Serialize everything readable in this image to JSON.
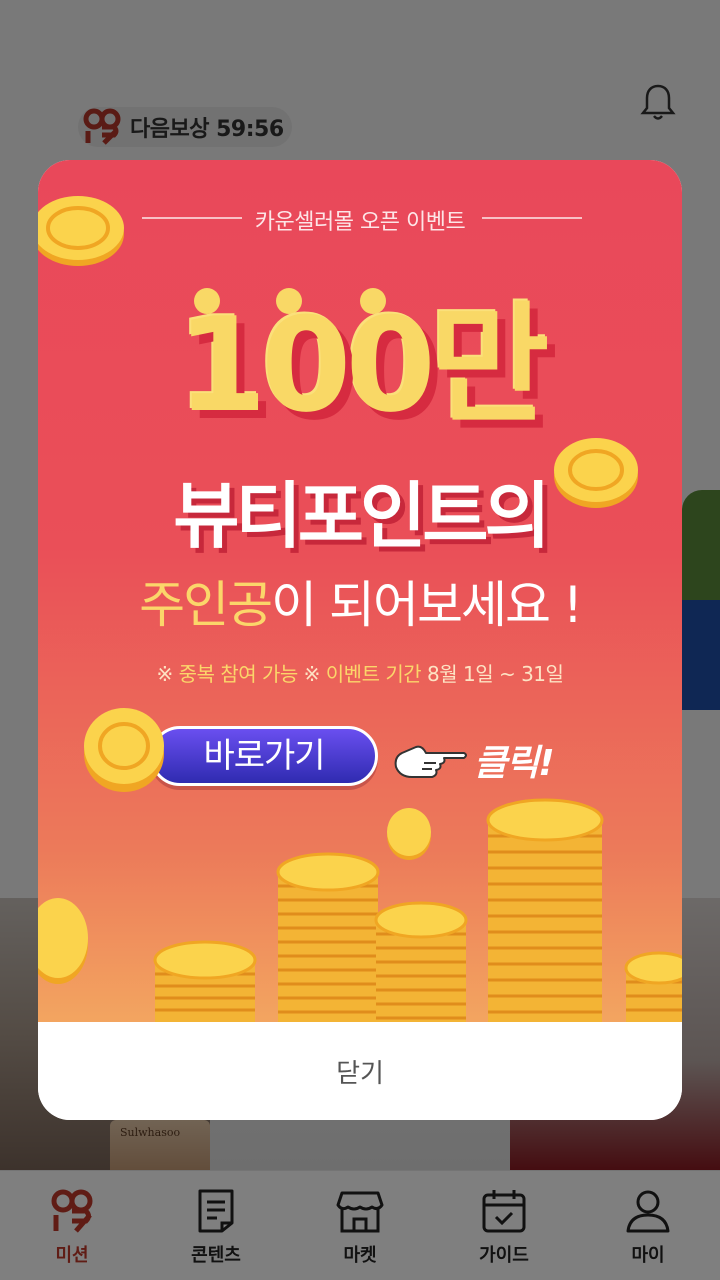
{
  "header": {
    "reward_label": "다음보상 59:56"
  },
  "background": {
    "product_brand": "Sulwhasoo"
  },
  "popup": {
    "event_title": "카운셀러몰 오픈 이벤트",
    "headline_number": "100만",
    "headline_line2": "뷰티포인트의",
    "headline_line3_highlight": "주인공",
    "headline_line3_rest": "이 되어보세요 !",
    "notice_mark1": "※",
    "notice_dup": "중복 참여 가능",
    "notice_mark2": "※",
    "notice_period_label": "이벤트 기간",
    "notice_period_value": "8월 1일 ~ 31일",
    "go_button": "바로가기",
    "click_hint": "클릭!",
    "close_label": "닫기",
    "banner_colors": {
      "top": "#e9485a",
      "bottom": "#f3a560",
      "button": "#3b32c2",
      "highlight": "#fbd66a"
    }
  },
  "bottom_nav": {
    "items": [
      {
        "label": "미션",
        "icon": "mission-logo-icon",
        "active": true
      },
      {
        "label": "콘텐츠",
        "icon": "document-icon",
        "active": false
      },
      {
        "label": "마켓",
        "icon": "store-icon",
        "active": false
      },
      {
        "label": "가이드",
        "icon": "calendar-check-icon",
        "active": false
      },
      {
        "label": "마이",
        "icon": "person-icon",
        "active": false
      }
    ]
  }
}
